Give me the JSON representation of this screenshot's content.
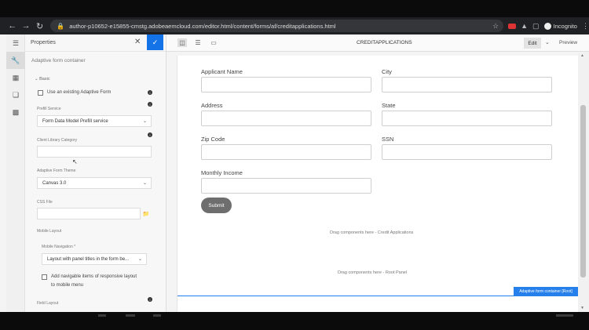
{
  "browser": {
    "url": "author-p10652-e15855-cmstg.adobeaemcloud.com/editor.html/content/forms/af/creditapplications.html",
    "profile": "Incognito"
  },
  "panel": {
    "title": "Properties",
    "subtitle": "Adaptive form container",
    "section": "Basic",
    "use_existing_label": "Use an existing Adaptive Form",
    "prefill_service_label": "Prefill Service",
    "prefill_service_value": "Form Data Model Prefill service",
    "client_library_label": "Client Library Category",
    "client_library_value": "",
    "theme_label": "Adaptive Form Theme",
    "theme_value": "Canvas 3.0",
    "css_file_label": "CSS File",
    "css_file_value": "",
    "mobile_layout_label": "Mobile Layout",
    "mobile_navigation_label": "Mobile Navigation *",
    "mobile_navigation_value": "Layout with panel titles in the form be...",
    "navigable_items_label_1": "Add navigable items of responsive layout",
    "navigable_items_label_2": "to mobile menu",
    "field_layout_label": "Field Layout"
  },
  "editor": {
    "page_title": "CREDITAPPLICATIONS",
    "edit_label": "Edit",
    "preview_label": "Preview"
  },
  "form": {
    "fields": {
      "applicant_name": "Applicant Name",
      "city": "City",
      "address": "Address",
      "state": "State",
      "zip_code": "Zip Code",
      "ssn": "SSN",
      "monthly_income": "Monthly Income"
    },
    "submit_label": "Submit",
    "drag_credit": "Drag components here - Credit Applications",
    "drag_root": "Drag components here - Root Panel",
    "selection_badge": "Adaptive form container [Root]"
  },
  "colors": {
    "accent": "#1473e6",
    "selection": "#2680eb",
    "submit": "#6e6e6e"
  }
}
